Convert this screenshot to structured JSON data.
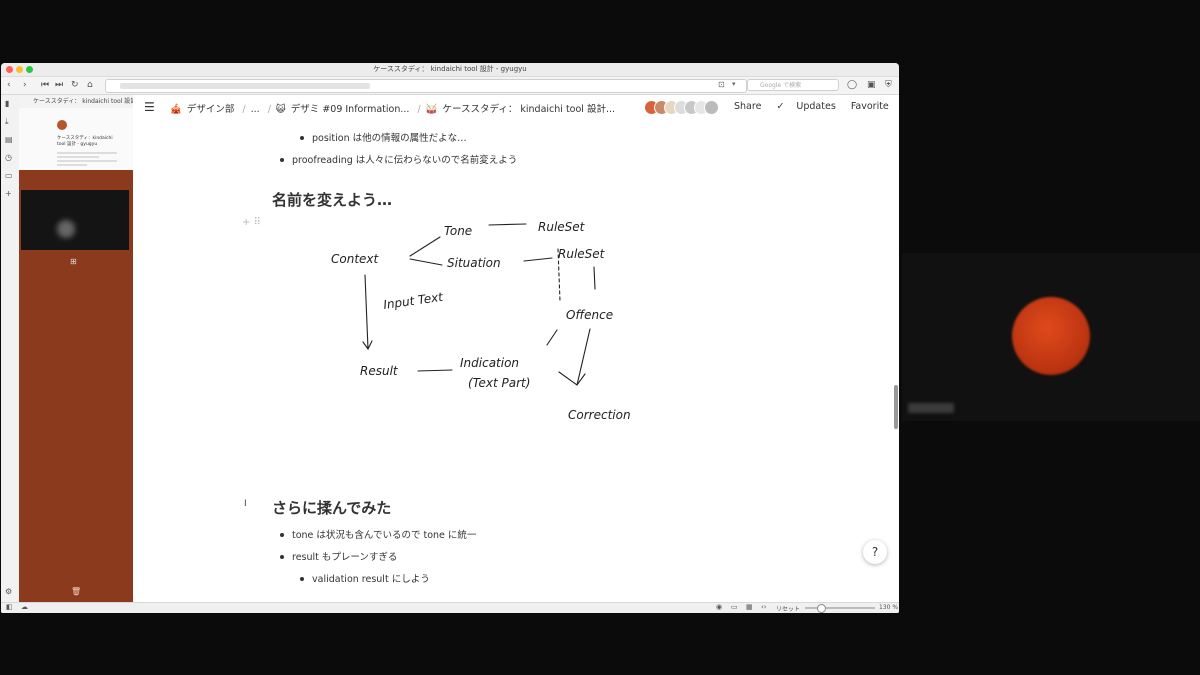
{
  "window": {
    "title": "ケーススタディ： kindaichi tool 設計 - gyugyu"
  },
  "toolbar": {
    "search_placeholder": "Google で検索"
  },
  "sidepanel": {
    "tab_title": "ケーススタディ： kindaichi tool 設計",
    "thumb_title": "ケーススタディ：kindaichi tool 設計 - gyugyu"
  },
  "breadcrumb": {
    "item1": "デザイン部",
    "item2": "...",
    "item3": "デザミ #09 Information...",
    "item4": "ケーススタディ： kindaichi tool 設計..."
  },
  "actions": {
    "share": "Share",
    "updates": "Updates",
    "favorite": "Favorite",
    "more": "•••"
  },
  "content": {
    "bullet_position": "position は他の情報の属性だよな…",
    "bullet_proofreading": "proofreading は人々に伝わらないので名前変えよう",
    "heading1": "名前を変えよう…",
    "sketch": {
      "tone": "Tone",
      "ruleset1": "RuleSet",
      "ruleset2": "RuleSet",
      "context": "Context",
      "situation": "Situation",
      "input_text": "Input Text",
      "offence": "Offence",
      "result": "Result",
      "indication": "Indication",
      "text_part": "(Text Part)",
      "correction": "Correction"
    },
    "heading2": "さらに揉んでみた",
    "bullet_tone": "tone は状況も含んでいるので tone に統一",
    "bullet_result": "result もプレーンすぎる",
    "bullet_validation": "validation result にしよう"
  },
  "help": "?",
  "statusbar": {
    "reset": "リセット",
    "zoom": "130 %"
  },
  "colors": {
    "sidebar_bg": "#8b3a1e",
    "avatar_orange": "#e04a1c"
  }
}
